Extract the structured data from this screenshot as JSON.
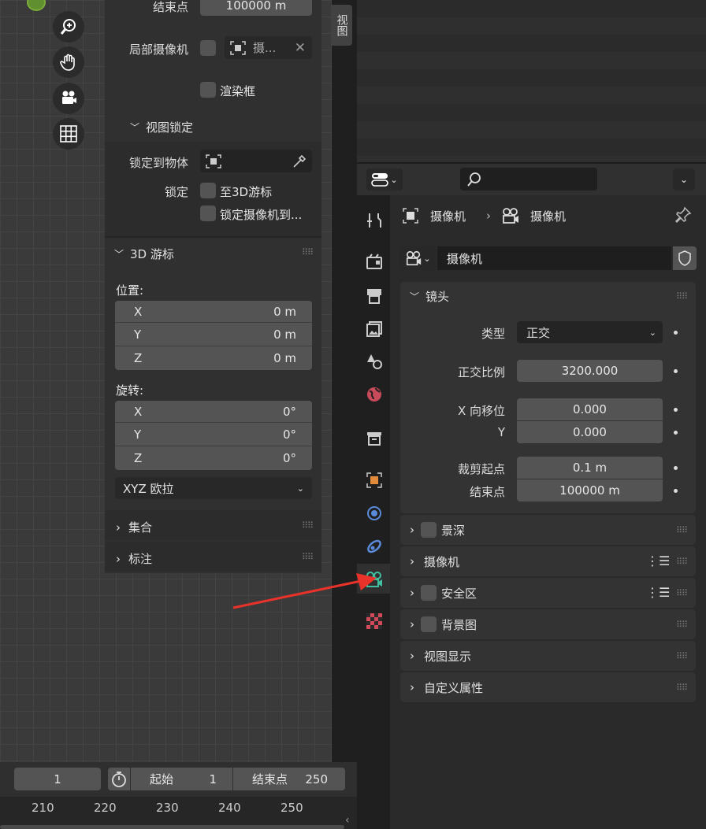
{
  "sidebar_tab": "视图",
  "view": {
    "clip_end_label": "结束点",
    "clip_end_value": "100000 m",
    "local_camera_label": "局部摄像机",
    "local_camera_value": "摄...",
    "render_region_label": "渲染框",
    "view_lock_title": "视图锁定",
    "lock_object_label": "锁定到物体",
    "lock_label": "锁定",
    "lock_3d_cursor": "至3D游标",
    "lock_camera": "锁定摄像机到..."
  },
  "cursor": {
    "title": "3D 游标",
    "location_label": "位置:",
    "location": [
      {
        "axis": "X",
        "value": "0 m"
      },
      {
        "axis": "Y",
        "value": "0 m"
      },
      {
        "axis": "Z",
        "value": "0 m"
      }
    ],
    "rotation_label": "旋转:",
    "rotation": [
      {
        "axis": "X",
        "value": "0°"
      },
      {
        "axis": "Y",
        "value": "0°"
      },
      {
        "axis": "Z",
        "value": "0°"
      }
    ],
    "rotation_mode": "XYZ 欧拉"
  },
  "collections_title": "集合",
  "annotations_title": "标注",
  "properties": {
    "breadcrumb": [
      "摄像机",
      "摄像机"
    ],
    "datablock_name": "摄像机",
    "lens": {
      "title": "镜头",
      "type_label": "类型",
      "type_value": "正交",
      "ortho_scale_label": "正交比例",
      "ortho_scale_value": "3200.000",
      "shift_x_label": "X 向移位",
      "shift_x_value": "0.000",
      "shift_y_label": "Y",
      "shift_y_value": "0.000",
      "clip_start_label": "裁剪起点",
      "clip_start_value": "0.1 m",
      "clip_end_label": "结束点",
      "clip_end_value": "100000 m"
    },
    "panels": [
      "景深",
      "摄像机",
      "安全区",
      "背景图",
      "视图显示",
      "自定义属性"
    ]
  },
  "timeline": {
    "current_frame": "1",
    "start_label": "起始",
    "start_value": "1",
    "end_label": "结束点",
    "end_value": "250",
    "ruler": [
      "210",
      "220",
      "230",
      "240",
      "250"
    ]
  },
  "colors": {
    "accent_arrow": "#e8322a",
    "camera_tab": "#3fbf9f"
  }
}
